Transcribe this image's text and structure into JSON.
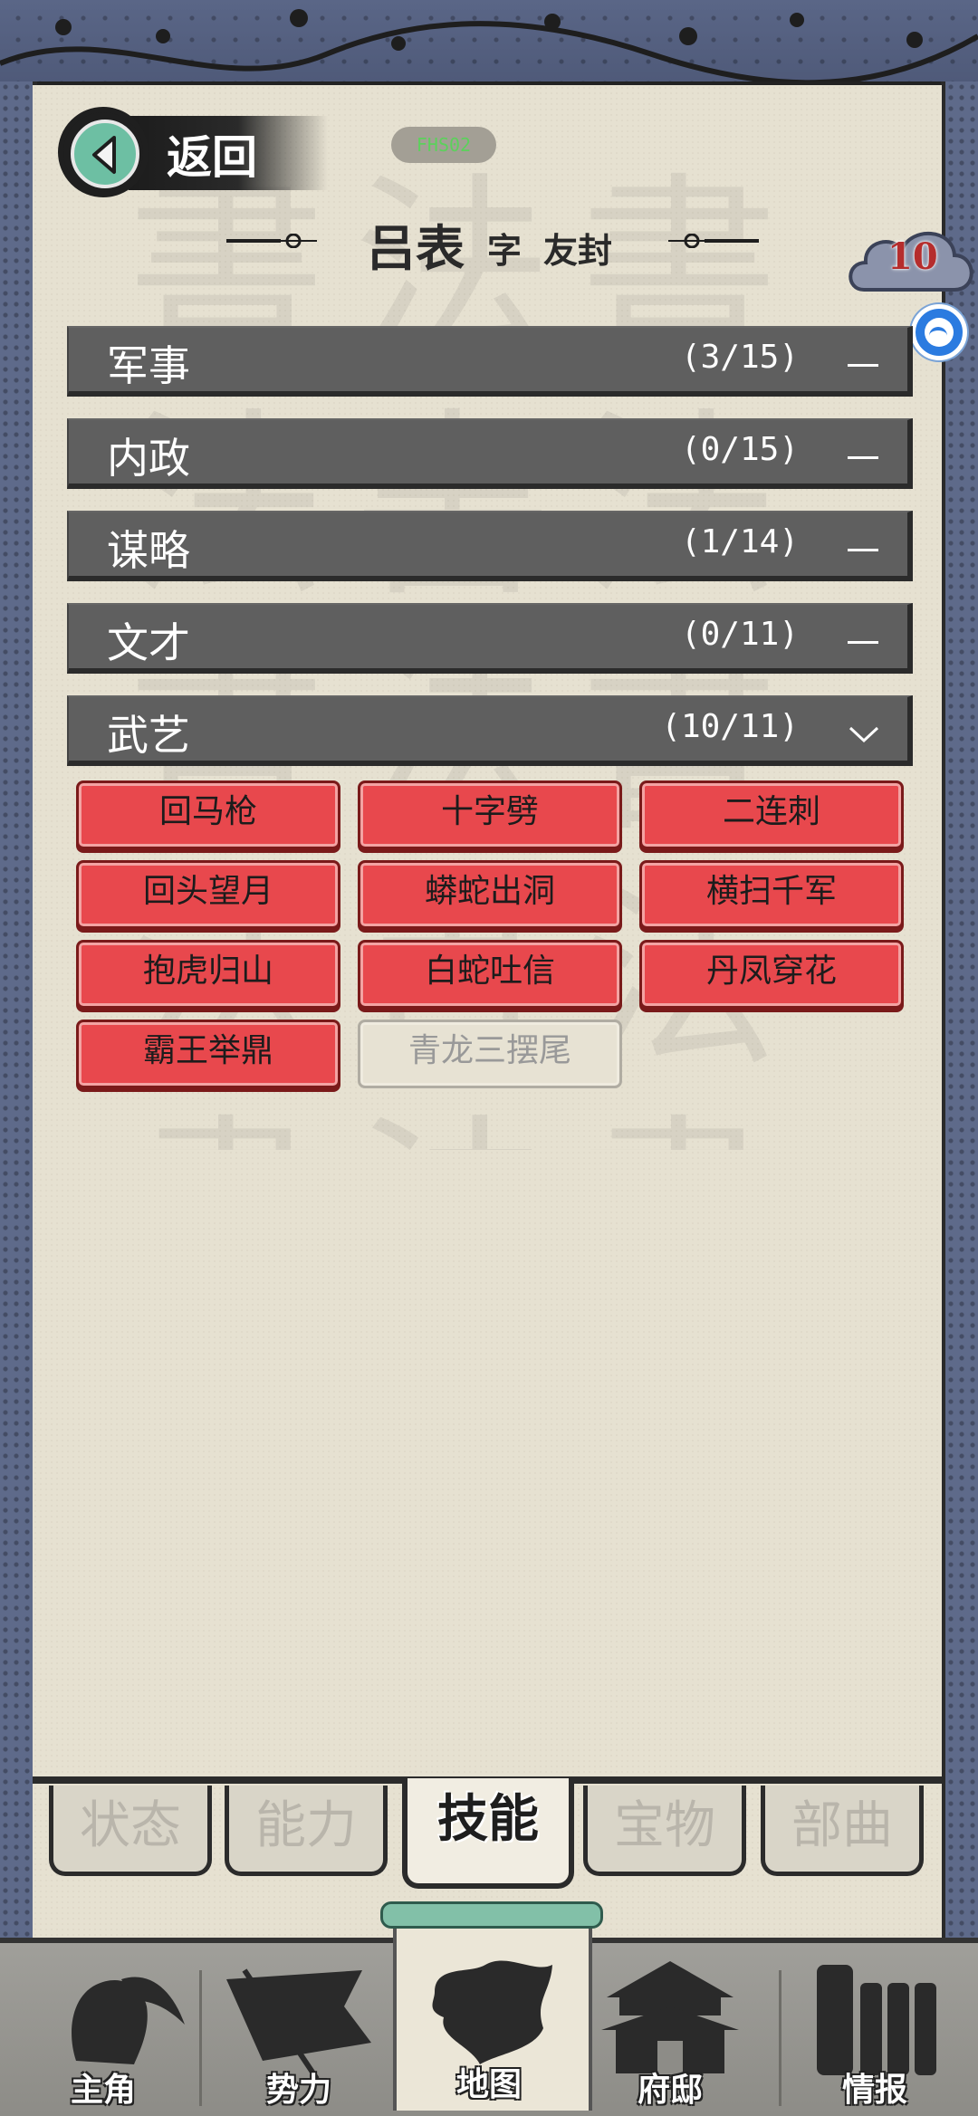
{
  "header": {
    "back_label": "返回",
    "pill_text": "FHS02"
  },
  "character": {
    "name": "吕表",
    "zi_label": "字",
    "courtesy_name": "友封"
  },
  "badges": {
    "cloud_number": "10"
  },
  "categories": [
    {
      "name": "军事",
      "count": "(3/15)",
      "state": "collapsed"
    },
    {
      "name": "内政",
      "count": "(0/15)",
      "state": "collapsed"
    },
    {
      "name": "谋略",
      "count": "(1/14)",
      "state": "collapsed"
    },
    {
      "name": "文才",
      "count": "(0/11)",
      "state": "collapsed"
    },
    {
      "name": "武艺",
      "count": "(10/11)",
      "state": "expanded"
    }
  ],
  "skills": [
    {
      "label": "回马枪",
      "learned": true
    },
    {
      "label": "十字劈",
      "learned": true
    },
    {
      "label": "二连刺",
      "learned": true
    },
    {
      "label": "回头望月",
      "learned": true
    },
    {
      "label": "蟒蛇出洞",
      "learned": true
    },
    {
      "label": "横扫千军",
      "learned": true
    },
    {
      "label": "抱虎归山",
      "learned": true
    },
    {
      "label": "白蛇吐信",
      "learned": true
    },
    {
      "label": "丹凤穿花",
      "learned": true
    },
    {
      "label": "霸王举鼎",
      "learned": true
    },
    {
      "label": "青龙三摆尾",
      "learned": false
    }
  ],
  "tabs": [
    {
      "label": "状态",
      "active": false
    },
    {
      "label": "能力",
      "active": false
    },
    {
      "label": "技能",
      "active": true
    },
    {
      "label": "宝物",
      "active": false
    },
    {
      "label": "部曲",
      "active": false
    }
  ],
  "bottom_nav": [
    {
      "label": "主角",
      "icon": "hero-portrait-icon"
    },
    {
      "label": "势力",
      "icon": "banner-flag-icon"
    },
    {
      "label": "地图",
      "icon": "map-icon",
      "active": true
    },
    {
      "label": "府邸",
      "icon": "mansion-icon"
    },
    {
      "label": "情报",
      "icon": "scrolls-icon"
    }
  ],
  "colors": {
    "skill_learned": "#e8484d",
    "skill_unlearned": "#e7e2d3",
    "category_bar": "#5f5f5f",
    "paper": "#e6e1d1",
    "frame": "#5f6a86"
  }
}
